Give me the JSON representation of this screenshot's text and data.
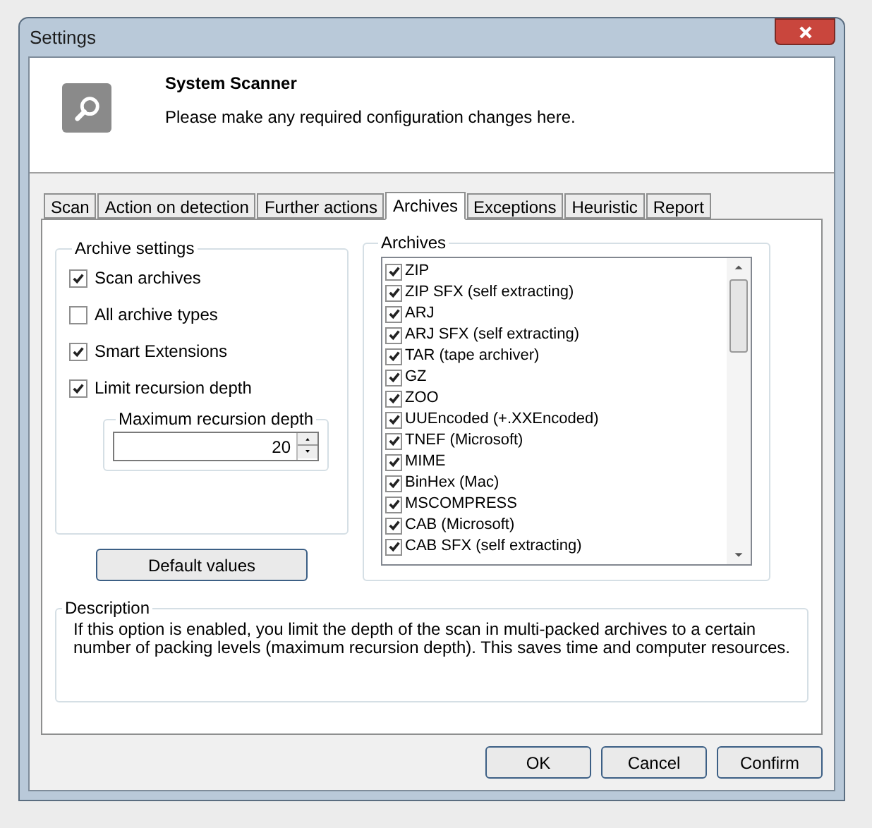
{
  "window": {
    "title": "Settings"
  },
  "header": {
    "title": "System Scanner",
    "subtitle": "Please make any required configuration changes here."
  },
  "tabs": [
    {
      "label": "Scan",
      "selected": false
    },
    {
      "label": "Action on detection",
      "selected": false
    },
    {
      "label": "Further actions",
      "selected": false
    },
    {
      "label": "Archives",
      "selected": true
    },
    {
      "label": "Exceptions",
      "selected": false
    },
    {
      "label": "Heuristic",
      "selected": false
    },
    {
      "label": "Report",
      "selected": false
    }
  ],
  "archive_settings": {
    "legend": "Archive settings",
    "options": [
      {
        "label": "Scan archives",
        "checked": true
      },
      {
        "label": "All archive types",
        "checked": false
      },
      {
        "label": "Smart Extensions",
        "checked": true
      },
      {
        "label": "Limit recursion depth",
        "checked": true
      }
    ],
    "max_depth": {
      "legend": "Maximum recursion depth",
      "value": "20"
    }
  },
  "default_button": "Default values",
  "archives": {
    "legend": "Archives",
    "items": [
      {
        "label": "ZIP",
        "checked": true
      },
      {
        "label": "ZIP SFX (self extracting)",
        "checked": true
      },
      {
        "label": "ARJ",
        "checked": true
      },
      {
        "label": "ARJ SFX (self extracting)",
        "checked": true
      },
      {
        "label": "TAR (tape archiver)",
        "checked": true
      },
      {
        "label": "GZ",
        "checked": true
      },
      {
        "label": "ZOO",
        "checked": true
      },
      {
        "label": "UUEncoded (+.XXEncoded)",
        "checked": true
      },
      {
        "label": "TNEF (Microsoft)",
        "checked": true
      },
      {
        "label": "MIME",
        "checked": true
      },
      {
        "label": "BinHex (Mac)",
        "checked": true
      },
      {
        "label": "MSCOMPRESS",
        "checked": true
      },
      {
        "label": "CAB (Microsoft)",
        "checked": true
      },
      {
        "label": "CAB SFX (self extracting)",
        "checked": true
      }
    ]
  },
  "description": {
    "legend": "Description",
    "text": "If this option is enabled, you limit the depth of the scan in multi-packed archives to a certain number of packing levels (maximum recursion depth). This saves time and computer resources."
  },
  "buttons": [
    "OK",
    "Cancel",
    "Confirm"
  ]
}
